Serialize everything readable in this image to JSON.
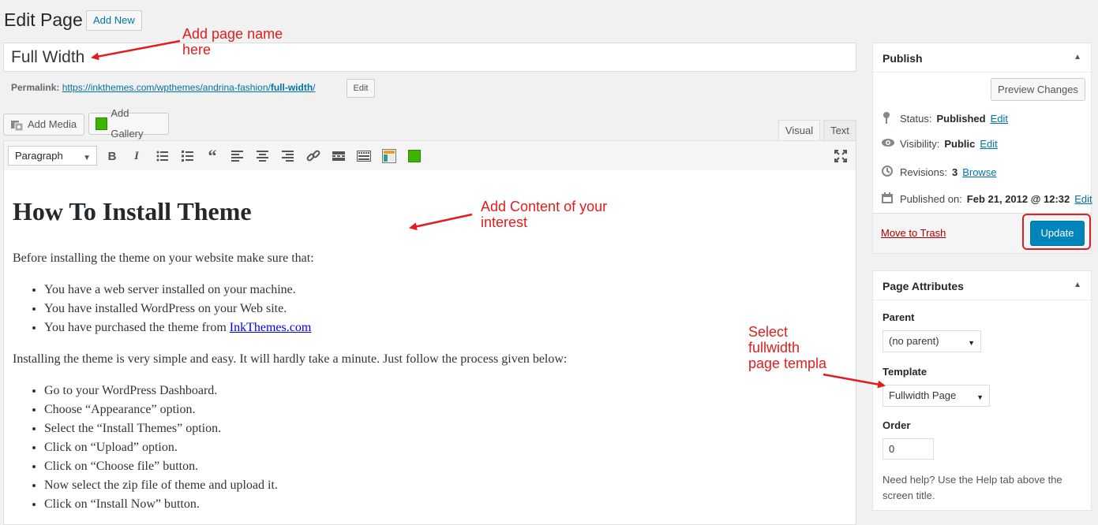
{
  "header": {
    "title": "Edit Page",
    "add_new_label": "Add New"
  },
  "title_field": {
    "value": "Full Width"
  },
  "permalink": {
    "label": "Permalink:",
    "url_prefix": "https://inkthemes.com/wpthemes/andrina-fashion/",
    "slug": "full-width",
    "url_suffix": "/",
    "edit_label": "Edit"
  },
  "media": {
    "add_media_label": "Add Media",
    "add_gallery_label": "Add Gallery"
  },
  "editor_tabs": {
    "visual": "Visual",
    "text": "Text",
    "active": "Visual"
  },
  "toolbar": {
    "format_value": "Paragraph",
    "icons": [
      "bold-icon",
      "italic-icon",
      "bullet-list-icon",
      "numbered-list-icon",
      "blockquote-icon",
      "align-left-icon",
      "align-center-icon",
      "align-right-icon",
      "link-icon",
      "read-more-icon",
      "toolbar-toggle-icon",
      "layout-plugin-icon",
      "green-plugin-icon",
      "fullscreen-icon"
    ]
  },
  "content": {
    "heading": "How To Install Theme",
    "intro": "Before installing the theme on your website make sure that:",
    "prereqs": [
      "You have a web server installed on your machine.",
      "You have installed WordPress on your Web site."
    ],
    "prereq_last_prefix": "You have purchased the theme from ",
    "prereq_last_link": "InkThemes.com",
    "process_intro": "Installing the theme is very simple and easy. It will hardly take a minute. Just follow the process given below:",
    "steps": [
      "Go to your WordPress Dashboard.",
      "Choose “Appearance” option.",
      "Select the “Install Themes” option.",
      "Click on “Upload” option.",
      "Click on “Choose file” button.",
      "Now select the zip file of theme and upload it.",
      "Click on “Install Now” button."
    ]
  },
  "publish": {
    "title": "Publish",
    "preview_label": "Preview Changes",
    "status_label": "Status:",
    "status_value": "Published",
    "visibility_label": "Visibility:",
    "visibility_value": "Public",
    "revisions_label": "Revisions:",
    "revisions_value": "3",
    "revisions_link": "Browse",
    "published_label": "Published on:",
    "published_value": "Feb 21, 2012 @ 12:32",
    "edit_link": "Edit",
    "trash_label": "Move to Trash",
    "update_label": "Update"
  },
  "page_attributes": {
    "title": "Page Attributes",
    "parent_label": "Parent",
    "parent_value": "(no parent)",
    "template_label": "Template",
    "template_value": "Fullwidth Page",
    "order_label": "Order",
    "order_value": "0",
    "help_text": "Need help? Use the Help tab above the screen title."
  },
  "annotations": {
    "name_note": [
      "Add page name",
      "here"
    ],
    "content_note": [
      "Add Content of your",
      "interest"
    ],
    "template_note": [
      "Select",
      "fullwidth",
      "page templa"
    ]
  },
  "colors": {
    "accent": "#0085ba",
    "annotation": "#e11d1d",
    "trash": "#a00000",
    "link": "#0073aa"
  }
}
